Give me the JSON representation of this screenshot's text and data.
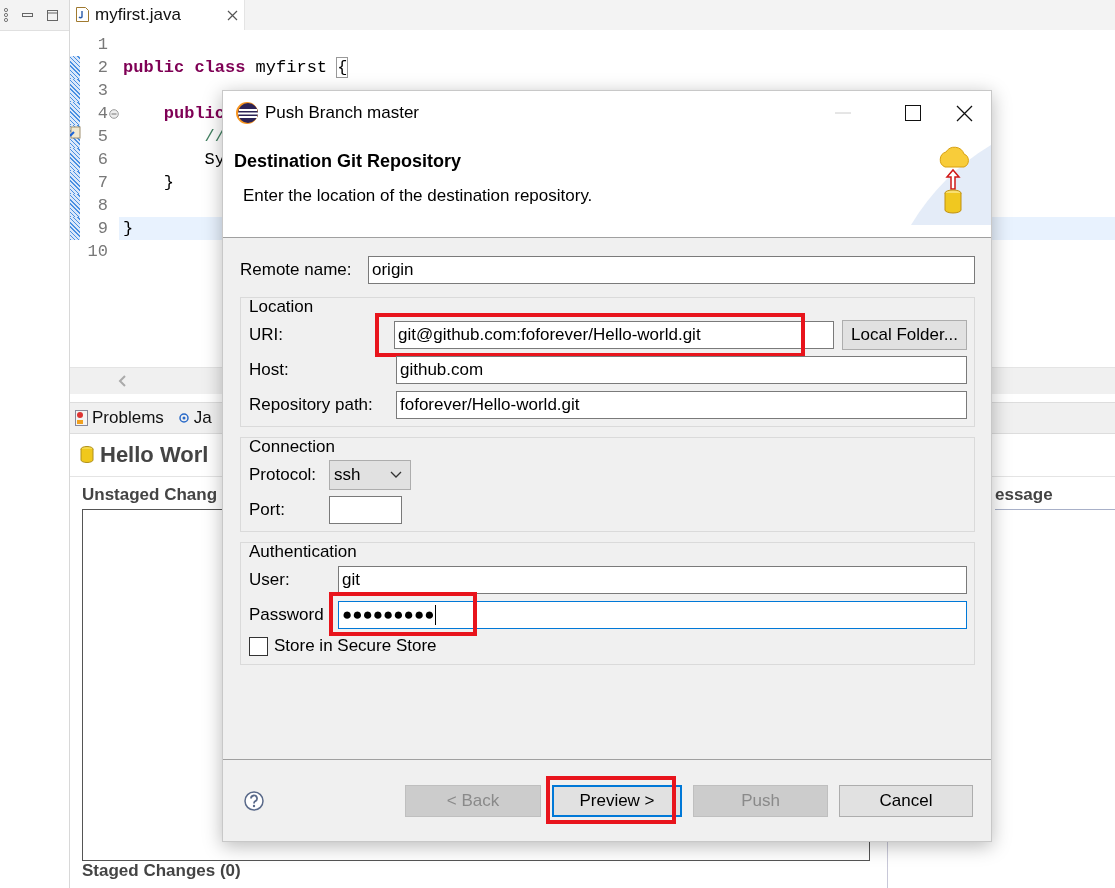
{
  "workbench": {
    "editor_tab": {
      "label": "myfirst.java",
      "selected": true
    },
    "code_lines": [
      {
        "number": "1",
        "changed": false,
        "current": false,
        "foldable": false,
        "task_marker": false
      },
      {
        "number": "2",
        "changed": true,
        "current": false,
        "foldable": false,
        "task_marker": false,
        "segments": [
          {
            "kind": "keyword",
            "text": "public class"
          },
          {
            "kind": "plain",
            "text": " myfirst "
          },
          {
            "kind": "bracket",
            "text": "{"
          }
        ]
      },
      {
        "number": "3",
        "changed": true,
        "current": false,
        "foldable": false,
        "task_marker": false
      },
      {
        "number": "4",
        "changed": true,
        "current": false,
        "foldable": true,
        "task_marker": false,
        "segments": [
          {
            "kind": "keyword",
            "text": "    public"
          }
        ]
      },
      {
        "number": "5",
        "changed": true,
        "current": false,
        "foldable": false,
        "task_marker": true,
        "segments": [
          {
            "kind": "comment",
            "text": "        //"
          }
        ]
      },
      {
        "number": "6",
        "changed": true,
        "current": false,
        "foldable": false,
        "task_marker": false,
        "segments": [
          {
            "kind": "plain",
            "text": "        Sy"
          }
        ]
      },
      {
        "number": "7",
        "changed": true,
        "current": false,
        "foldable": false,
        "task_marker": false,
        "segments": [
          {
            "kind": "plain",
            "text": "    }"
          }
        ]
      },
      {
        "number": "8",
        "changed": true,
        "current": false,
        "foldable": false,
        "task_marker": false
      },
      {
        "number": "9",
        "changed": true,
        "current": true,
        "foldable": false,
        "task_marker": false,
        "segments": [
          {
            "kind": "plain",
            "text": "}"
          }
        ]
      },
      {
        "number": "10",
        "changed": false,
        "current": false,
        "foldable": false,
        "task_marker": false
      }
    ],
    "view_tabs": [
      {
        "label": "Problems",
        "kind": "problems"
      },
      {
        "label": "Ja",
        "kind": "javadoc"
      }
    ],
    "staging": {
      "title": "Hello Worl",
      "unstaged_heading": "Unstaged Chang",
      "message_heading": "essage",
      "staged_heading": "Staged Changes (0)"
    }
  },
  "dialog": {
    "title": "Push Branch master",
    "page_title": "Destination Git Repository",
    "page_description": "Enter the location of the destination repository.",
    "remote_name": {
      "label": "Remote name:",
      "value": "origin"
    },
    "location": {
      "legend": "Location",
      "uri": {
        "label": "URI:",
        "value": "git@github.com:foforever/Hello-world.git",
        "highlighted": true
      },
      "local_folder_button": "Local Folder...",
      "host": {
        "label": "Host:",
        "value": "github.com"
      },
      "repository_path": {
        "label": "Repository path:",
        "value": "foforever/Hello-world.git"
      }
    },
    "connection": {
      "legend": "Connection",
      "protocol": {
        "label": "Protocol:",
        "value": "ssh"
      },
      "port": {
        "label": "Port:"
      }
    },
    "authentication": {
      "legend": "Authentication",
      "user": {
        "label": "User:",
        "value": "git"
      },
      "password": {
        "label": "Password",
        "value": "●●●●●●●●●",
        "focused": true,
        "highlighted": true
      },
      "store": {
        "label": "Store in Secure Store",
        "checked": false
      }
    },
    "buttons": [
      {
        "label": "< Back",
        "disabled": true,
        "default": false,
        "highlighted": false
      },
      {
        "label": "Preview >",
        "disabled": false,
        "default": true,
        "highlighted": true
      },
      {
        "label": "Push",
        "disabled": true,
        "default": false,
        "highlighted": false
      },
      {
        "label": "Cancel",
        "disabled": false,
        "default": false,
        "highlighted": false
      }
    ]
  }
}
